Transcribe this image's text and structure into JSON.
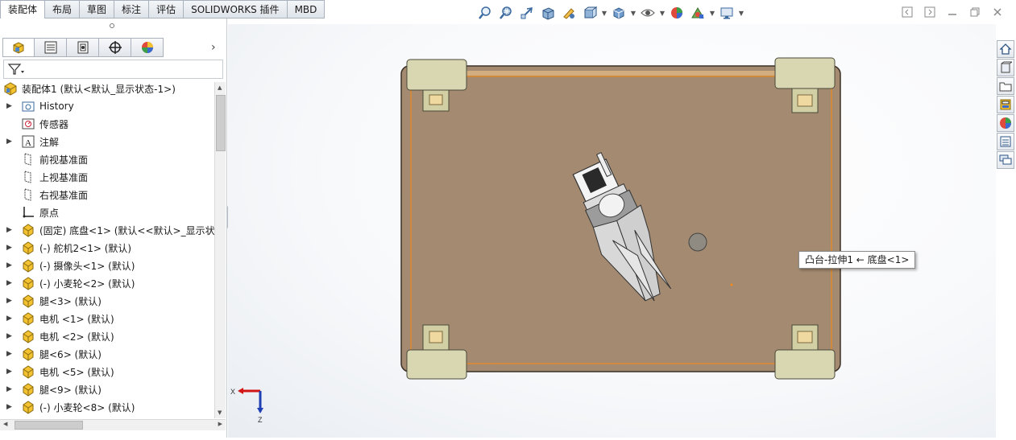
{
  "command_tabs": [
    "装配体",
    "布局",
    "草图",
    "标注",
    "评估",
    "SOLIDWORKS 插件",
    "MBD"
  ],
  "heads_up_toolbar": [
    "zoom-to-fit-icon",
    "zoom-to-area-icon",
    "previous-view-icon",
    "section-view-icon",
    "dynamic-annotation-icon",
    "view-orientation-icon",
    "display-style-icon",
    "hide-show-items-icon",
    "edit-appearance-icon",
    "apply-scene-icon",
    "view-settings-icon"
  ],
  "panel_tabs": [
    "featuremanager-tab",
    "propertymanager-tab",
    "configurationmanager-tab",
    "dimxpert-tab",
    "displaymanager-tab"
  ],
  "tree": {
    "root": "装配体1  (默认<默认_显示状态-1>)",
    "items": [
      {
        "label": "History",
        "icon": "history-folder-icon",
        "expand": true
      },
      {
        "label": "传感器",
        "icon": "sensors-icon",
        "expand": false
      },
      {
        "label": "注解",
        "icon": "annotations-icon",
        "expand": true
      },
      {
        "label": "前视基准面",
        "icon": "plane-icon",
        "expand": false
      },
      {
        "label": "上视基准面",
        "icon": "plane-icon",
        "expand": false
      },
      {
        "label": "右视基准面",
        "icon": "plane-icon",
        "expand": false
      },
      {
        "label": "原点",
        "icon": "origin-icon",
        "expand": false
      },
      {
        "label": "(固定) 底盘<1> (默认<<默认>_显示状态",
        "icon": "part-icon",
        "expand": true
      },
      {
        "label": "(-) 舵机2<1> (默认)",
        "icon": "part-icon",
        "expand": true
      },
      {
        "label": "(-) 摄像头<1> (默认)",
        "icon": "part-icon",
        "expand": true
      },
      {
        "label": "(-) 小麦轮<2> (默认)",
        "icon": "part-icon",
        "expand": true
      },
      {
        "label": "腿<3> (默认)",
        "icon": "part-icon",
        "expand": true
      },
      {
        "label": "电机 <1> (默认)",
        "icon": "part-icon",
        "expand": true
      },
      {
        "label": "电机 <2> (默认)",
        "icon": "part-icon",
        "expand": true
      },
      {
        "label": "腿<6> (默认)",
        "icon": "part-icon",
        "expand": true
      },
      {
        "label": "电机 <5> (默认)",
        "icon": "part-icon",
        "expand": true
      },
      {
        "label": "腿<9> (默认)",
        "icon": "part-icon",
        "expand": true
      },
      {
        "label": "(-) 小麦轮<8> (默认)",
        "icon": "part-icon",
        "expand": true
      }
    ]
  },
  "tooltip": "凸台-拉伸1 ← 底盘<1>",
  "triad": {
    "x_label": "X",
    "z_label": "Z"
  },
  "task_pane_buttons": [
    "home-icon",
    "design-library-icon",
    "file-explorer-icon",
    "view-palette-icon",
    "appearances-icon",
    "custom-properties-icon",
    "forum-icon"
  ],
  "colors": {
    "chassis": "#a38a70",
    "accent_orange": "#f08a1c",
    "axis_x": "#d21414",
    "axis_z": "#1f3fb5"
  }
}
